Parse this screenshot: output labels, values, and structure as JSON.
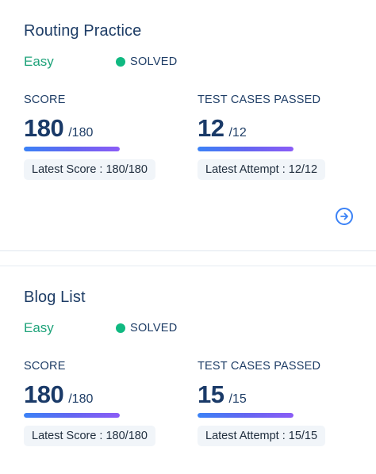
{
  "problems": [
    {
      "title": "Routing Practice",
      "difficulty": "Easy",
      "status": "SOLVED",
      "score": {
        "label": "SCORE",
        "value": "180",
        "total": "/180",
        "progress_fraction": 1.0,
        "latest_text": "Latest Score : 180/180"
      },
      "tests": {
        "label": "TEST CASES PASSED",
        "value": "12",
        "total": "/12",
        "progress_fraction": 1.0,
        "latest_text": "Latest Attempt : 12/12"
      },
      "open_icon": "arrow-right-circle-icon"
    },
    {
      "title": "Blog List",
      "difficulty": "Easy",
      "status": "SOLVED",
      "score": {
        "label": "SCORE",
        "value": "180",
        "total": "/180",
        "progress_fraction": 1.0,
        "latest_text": "Latest Score : 180/180"
      },
      "tests": {
        "label": "TEST CASES PASSED",
        "value": "15",
        "total": "/15",
        "progress_fraction": 1.0,
        "latest_text": "Latest Attempt : 15/15"
      }
    }
  ],
  "colors": {
    "difficulty_easy": "#1fa37a",
    "solved_dot": "#10b981",
    "title": "#1e3d66",
    "accent": "#3b82f6",
    "progress_start": "#3b82f6",
    "progress_end": "#8b5cf6",
    "chip_bg": "#f1f5f9"
  }
}
